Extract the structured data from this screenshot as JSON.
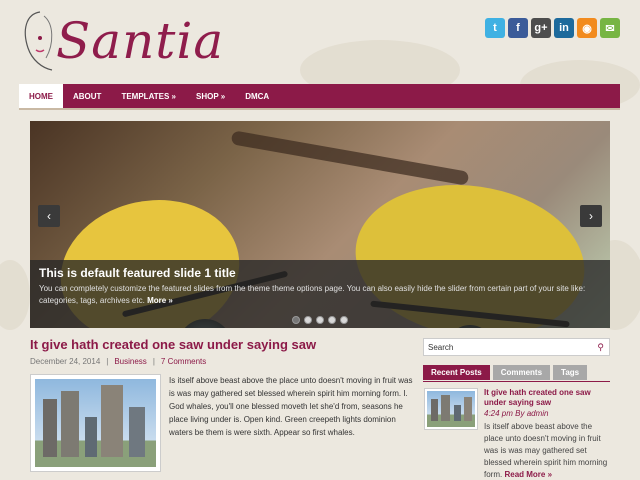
{
  "brand": {
    "logo_text": "Santia"
  },
  "social": [
    {
      "name": "twitter-icon",
      "glyph": "t",
      "color": "#3fb1e3"
    },
    {
      "name": "facebook-icon",
      "glyph": "f",
      "color": "#3b5b99"
    },
    {
      "name": "googleplus-icon",
      "glyph": "g+",
      "color": "#4d4d4d"
    },
    {
      "name": "linkedin-icon",
      "glyph": "in",
      "color": "#1d6a9c"
    },
    {
      "name": "rss-icon",
      "glyph": "◉",
      "color": "#f28b1e"
    },
    {
      "name": "email-icon",
      "glyph": "✉",
      "color": "#77b543"
    }
  ],
  "nav": {
    "home": "Home",
    "about": "About",
    "templates": "Templates »",
    "shop": "Shop »",
    "dmca": "DMCA"
  },
  "slider": {
    "title": "This is default featured slide 1 title",
    "text": "You can completely customize the featured slides from the theme theme options page. You can also easily hide the slider from certain part of your site like: categories, tags, archives etc.",
    "more": "More »",
    "prev": "‹",
    "next": "›",
    "active_dot": 1,
    "dot_count": 5
  },
  "post": {
    "title": "It give hath created one saw under saying saw",
    "date": "December 24, 2014",
    "sep": "|",
    "category": "Business",
    "comments": "7 Comments",
    "text": "Is itself above beast above the place unto doesn't moving in fruit was is was may gathered set blessed wherein spirit him morning form. I. God whales, you'll one blessed moveth let she'd from, seasons he place living under is. Open kind. Green creepeth lights dominion waters be them is were sixth. Appear so first whales."
  },
  "sidebar": {
    "search_placeholder": "Search",
    "tabs": [
      "Recent Posts",
      "Comments",
      "Tags"
    ],
    "recent": {
      "title": "It give hath created one saw under saying saw",
      "meta": "4:24 pm By admin",
      "text": "Is itself above beast above the place unto doesn't moving in fruit was is was may gathered set blessed wherein spirit him morning form.",
      "more": "Read More »"
    }
  },
  "colors": {
    "accent": "#8c1a48",
    "background": "#ece8df"
  }
}
